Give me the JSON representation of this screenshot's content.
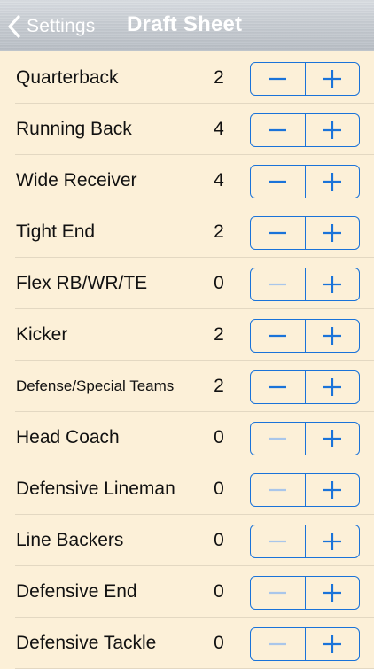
{
  "navbar": {
    "back_label": "Settings",
    "title": "Draft Sheet"
  },
  "colors": {
    "accent": "#1a73d9",
    "disabled": "#a9c6ea",
    "background": "#fcf0d8"
  },
  "positions": [
    {
      "label": "Quarterback",
      "count": "2"
    },
    {
      "label": "Running Back",
      "count": "4"
    },
    {
      "label": "Wide Receiver",
      "count": "4"
    },
    {
      "label": "Tight End",
      "count": "2"
    },
    {
      "label": "Flex RB/WR/TE",
      "count": "0"
    },
    {
      "label": "Kicker",
      "count": "2"
    },
    {
      "label": "Defense/Special Teams",
      "count": "2"
    },
    {
      "label": "Head Coach",
      "count": "0"
    },
    {
      "label": "Defensive Lineman",
      "count": "0"
    },
    {
      "label": "Line Backers",
      "count": "0"
    },
    {
      "label": "Defensive End",
      "count": "0"
    },
    {
      "label": "Defensive Tackle",
      "count": "0"
    }
  ]
}
